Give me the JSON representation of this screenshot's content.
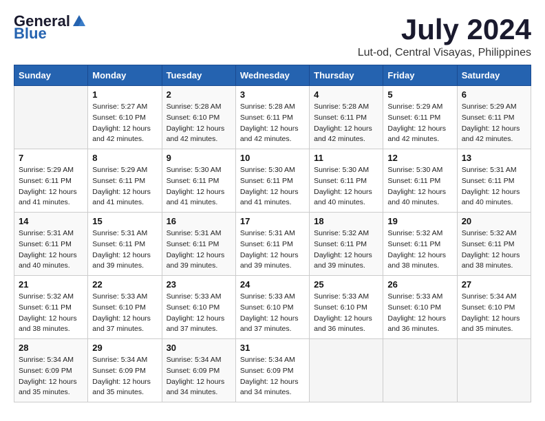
{
  "header": {
    "logo_general": "General",
    "logo_blue": "Blue",
    "month": "July 2024",
    "location": "Lut-od, Central Visayas, Philippines"
  },
  "weekdays": [
    "Sunday",
    "Monday",
    "Tuesday",
    "Wednesday",
    "Thursday",
    "Friday",
    "Saturday"
  ],
  "weeks": [
    [
      {
        "day": "",
        "sunrise": "",
        "sunset": "",
        "daylight": ""
      },
      {
        "day": "1",
        "sunrise": "Sunrise: 5:27 AM",
        "sunset": "Sunset: 6:10 PM",
        "daylight": "Daylight: 12 hours and 42 minutes."
      },
      {
        "day": "2",
        "sunrise": "Sunrise: 5:28 AM",
        "sunset": "Sunset: 6:10 PM",
        "daylight": "Daylight: 12 hours and 42 minutes."
      },
      {
        "day": "3",
        "sunrise": "Sunrise: 5:28 AM",
        "sunset": "Sunset: 6:11 PM",
        "daylight": "Daylight: 12 hours and 42 minutes."
      },
      {
        "day": "4",
        "sunrise": "Sunrise: 5:28 AM",
        "sunset": "Sunset: 6:11 PM",
        "daylight": "Daylight: 12 hours and 42 minutes."
      },
      {
        "day": "5",
        "sunrise": "Sunrise: 5:29 AM",
        "sunset": "Sunset: 6:11 PM",
        "daylight": "Daylight: 12 hours and 42 minutes."
      },
      {
        "day": "6",
        "sunrise": "Sunrise: 5:29 AM",
        "sunset": "Sunset: 6:11 PM",
        "daylight": "Daylight: 12 hours and 42 minutes."
      }
    ],
    [
      {
        "day": "7",
        "sunrise": "Sunrise: 5:29 AM",
        "sunset": "Sunset: 6:11 PM",
        "daylight": "Daylight: 12 hours and 41 minutes."
      },
      {
        "day": "8",
        "sunrise": "Sunrise: 5:29 AM",
        "sunset": "Sunset: 6:11 PM",
        "daylight": "Daylight: 12 hours and 41 minutes."
      },
      {
        "day": "9",
        "sunrise": "Sunrise: 5:30 AM",
        "sunset": "Sunset: 6:11 PM",
        "daylight": "Daylight: 12 hours and 41 minutes."
      },
      {
        "day": "10",
        "sunrise": "Sunrise: 5:30 AM",
        "sunset": "Sunset: 6:11 PM",
        "daylight": "Daylight: 12 hours and 41 minutes."
      },
      {
        "day": "11",
        "sunrise": "Sunrise: 5:30 AM",
        "sunset": "Sunset: 6:11 PM",
        "daylight": "Daylight: 12 hours and 40 minutes."
      },
      {
        "day": "12",
        "sunrise": "Sunrise: 5:30 AM",
        "sunset": "Sunset: 6:11 PM",
        "daylight": "Daylight: 12 hours and 40 minutes."
      },
      {
        "day": "13",
        "sunrise": "Sunrise: 5:31 AM",
        "sunset": "Sunset: 6:11 PM",
        "daylight": "Daylight: 12 hours and 40 minutes."
      }
    ],
    [
      {
        "day": "14",
        "sunrise": "Sunrise: 5:31 AM",
        "sunset": "Sunset: 6:11 PM",
        "daylight": "Daylight: 12 hours and 40 minutes."
      },
      {
        "day": "15",
        "sunrise": "Sunrise: 5:31 AM",
        "sunset": "Sunset: 6:11 PM",
        "daylight": "Daylight: 12 hours and 39 minutes."
      },
      {
        "day": "16",
        "sunrise": "Sunrise: 5:31 AM",
        "sunset": "Sunset: 6:11 PM",
        "daylight": "Daylight: 12 hours and 39 minutes."
      },
      {
        "day": "17",
        "sunrise": "Sunrise: 5:31 AM",
        "sunset": "Sunset: 6:11 PM",
        "daylight": "Daylight: 12 hours and 39 minutes."
      },
      {
        "day": "18",
        "sunrise": "Sunrise: 5:32 AM",
        "sunset": "Sunset: 6:11 PM",
        "daylight": "Daylight: 12 hours and 39 minutes."
      },
      {
        "day": "19",
        "sunrise": "Sunrise: 5:32 AM",
        "sunset": "Sunset: 6:11 PM",
        "daylight": "Daylight: 12 hours and 38 minutes."
      },
      {
        "day": "20",
        "sunrise": "Sunrise: 5:32 AM",
        "sunset": "Sunset: 6:11 PM",
        "daylight": "Daylight: 12 hours and 38 minutes."
      }
    ],
    [
      {
        "day": "21",
        "sunrise": "Sunrise: 5:32 AM",
        "sunset": "Sunset: 6:11 PM",
        "daylight": "Daylight: 12 hours and 38 minutes."
      },
      {
        "day": "22",
        "sunrise": "Sunrise: 5:33 AM",
        "sunset": "Sunset: 6:10 PM",
        "daylight": "Daylight: 12 hours and 37 minutes."
      },
      {
        "day": "23",
        "sunrise": "Sunrise: 5:33 AM",
        "sunset": "Sunset: 6:10 PM",
        "daylight": "Daylight: 12 hours and 37 minutes."
      },
      {
        "day": "24",
        "sunrise": "Sunrise: 5:33 AM",
        "sunset": "Sunset: 6:10 PM",
        "daylight": "Daylight: 12 hours and 37 minutes."
      },
      {
        "day": "25",
        "sunrise": "Sunrise: 5:33 AM",
        "sunset": "Sunset: 6:10 PM",
        "daylight": "Daylight: 12 hours and 36 minutes."
      },
      {
        "day": "26",
        "sunrise": "Sunrise: 5:33 AM",
        "sunset": "Sunset: 6:10 PM",
        "daylight": "Daylight: 12 hours and 36 minutes."
      },
      {
        "day": "27",
        "sunrise": "Sunrise: 5:34 AM",
        "sunset": "Sunset: 6:10 PM",
        "daylight": "Daylight: 12 hours and 35 minutes."
      }
    ],
    [
      {
        "day": "28",
        "sunrise": "Sunrise: 5:34 AM",
        "sunset": "Sunset: 6:09 PM",
        "daylight": "Daylight: 12 hours and 35 minutes."
      },
      {
        "day": "29",
        "sunrise": "Sunrise: 5:34 AM",
        "sunset": "Sunset: 6:09 PM",
        "daylight": "Daylight: 12 hours and 35 minutes."
      },
      {
        "day": "30",
        "sunrise": "Sunrise: 5:34 AM",
        "sunset": "Sunset: 6:09 PM",
        "daylight": "Daylight: 12 hours and 34 minutes."
      },
      {
        "day": "31",
        "sunrise": "Sunrise: 5:34 AM",
        "sunset": "Sunset: 6:09 PM",
        "daylight": "Daylight: 12 hours and 34 minutes."
      },
      {
        "day": "",
        "sunrise": "",
        "sunset": "",
        "daylight": ""
      },
      {
        "day": "",
        "sunrise": "",
        "sunset": "",
        "daylight": ""
      },
      {
        "day": "",
        "sunrise": "",
        "sunset": "",
        "daylight": ""
      }
    ]
  ]
}
